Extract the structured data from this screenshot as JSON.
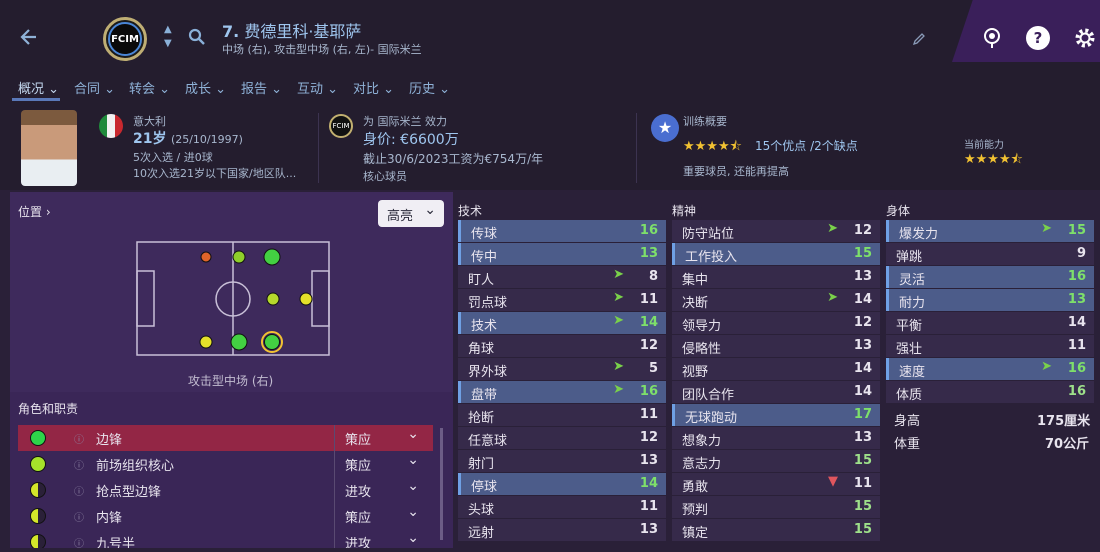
{
  "header": {
    "number": "7.",
    "name": "费德里科·基耶萨",
    "positions": "中场 (右), 攻击型中场 (右, 左)- 国际米兰",
    "club_abbr": "FCIM"
  },
  "tabs": [
    "概况",
    "合同",
    "转会",
    "成长",
    "报告",
    "互动",
    "对比",
    "历史"
  ],
  "personal": {
    "nationality": "意大利",
    "age": "21岁",
    "dob": "(25/10/1997)",
    "caps": "5次入选 / 进0球",
    "youth": "10次入选21岁以下国家/地区队..."
  },
  "contract": {
    "club": "为 国际米兰 效力",
    "value": "身价: €6600万",
    "wage": "截止30/6/2023工资为€754万/年",
    "status": "核心球员"
  },
  "training": {
    "title": "训练概要",
    "strengths": "15个优点",
    "weaknesses": "/2个缺点",
    "note": "重要球员, 还能再提高",
    "ca_label": "当前能力",
    "ca_stars": 4.5,
    "summary_stars": 4.5
  },
  "position": {
    "title": "位置",
    "highlight": "高亮",
    "current": "攻击型中场 (右)"
  },
  "roles": {
    "title": "角色和职责",
    "items": [
      {
        "name": "边锋",
        "duty": "策应",
        "color": "#2ed44a"
      },
      {
        "name": "前场组织核心",
        "duty": "策应",
        "color": "#a6e22a"
      },
      {
        "name": "抢点型边锋",
        "duty": "进攻",
        "color": "#d4e62a"
      },
      {
        "name": "内锋",
        "duty": "策应",
        "color": "#d4e62a"
      },
      {
        "name": "九号半",
        "duty": "进攻",
        "color": "#d4e62a"
      }
    ]
  },
  "stats": {
    "technical": {
      "title": "技术",
      "rows": [
        {
          "n": "传球",
          "v": "16",
          "hl": true
        },
        {
          "n": "传中",
          "v": "13",
          "hl": true
        },
        {
          "n": "盯人",
          "v": "8",
          "arrow": "up"
        },
        {
          "n": "罚点球",
          "v": "11",
          "arrow": "up"
        },
        {
          "n": "技术",
          "v": "14",
          "hl": true,
          "arrow": "up"
        },
        {
          "n": "角球",
          "v": "12"
        },
        {
          "n": "界外球",
          "v": "5",
          "arrow": "up"
        },
        {
          "n": "盘带",
          "v": "16",
          "hl": true,
          "arrow": "up"
        },
        {
          "n": "抢断",
          "v": "11"
        },
        {
          "n": "任意球",
          "v": "12"
        },
        {
          "n": "射门",
          "v": "13"
        },
        {
          "n": "停球",
          "v": "14",
          "hl": true
        },
        {
          "n": "头球",
          "v": "11"
        },
        {
          "n": "远射",
          "v": "13"
        }
      ]
    },
    "mental": {
      "title": "精神",
      "rows": [
        {
          "n": "防守站位",
          "v": "12",
          "arrow": "up"
        },
        {
          "n": "工作投入",
          "v": "15",
          "hl": true
        },
        {
          "n": "集中",
          "v": "13"
        },
        {
          "n": "决断",
          "v": "14",
          "arrow": "up"
        },
        {
          "n": "领导力",
          "v": "12"
        },
        {
          "n": "侵略性",
          "v": "13"
        },
        {
          "n": "视野",
          "v": "14"
        },
        {
          "n": "团队合作",
          "v": "14"
        },
        {
          "n": "无球跑动",
          "v": "17",
          "hl": true
        },
        {
          "n": "想象力",
          "v": "13"
        },
        {
          "n": "意志力",
          "v": "15"
        },
        {
          "n": "勇敢",
          "v": "11",
          "arrow": "down"
        },
        {
          "n": "预判",
          "v": "15"
        },
        {
          "n": "镇定",
          "v": "15"
        }
      ]
    },
    "physical": {
      "title": "身体",
      "rows": [
        {
          "n": "爆发力",
          "v": "15",
          "hl": true,
          "arrow": "up"
        },
        {
          "n": "弹跳",
          "v": "9"
        },
        {
          "n": "灵活",
          "v": "16",
          "hl": true
        },
        {
          "n": "耐力",
          "v": "13",
          "hl": true
        },
        {
          "n": "平衡",
          "v": "14"
        },
        {
          "n": "强壮",
          "v": "11"
        },
        {
          "n": "速度",
          "v": "16",
          "hl": true,
          "arrow": "up"
        },
        {
          "n": "体质",
          "v": "16"
        }
      ]
    },
    "height_label": "身高",
    "height": "175厘米",
    "weight_label": "体重",
    "weight": "70公斤"
  }
}
